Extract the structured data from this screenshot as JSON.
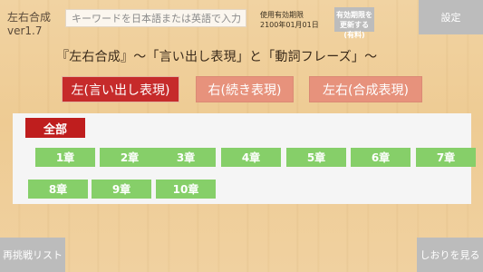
{
  "header": {
    "app_name": "左右合成",
    "version": "ver1.7",
    "search_placeholder": "キーワードを日本語または英語で入力",
    "expiry_label": "使用有効期限",
    "expiry_date": "2100年01月01日",
    "renew_label_1": "有効期限を",
    "renew_label_2": "更新する(有料)",
    "settings_label": "設定"
  },
  "subtitle": "『左右合成』～「言い出し表現」と「動詞フレーズ」～",
  "modes": {
    "left": "左(言い出し表現)",
    "right": "右(続き表現)",
    "both": "左右(合成表現)"
  },
  "chapters": {
    "all_label": "全部",
    "items": [
      "1章",
      "2章",
      "3章",
      "4章",
      "5章",
      "6章",
      "7章",
      "8章",
      "9章",
      "10章"
    ]
  },
  "footer": {
    "retry_label": "再挑戦リスト",
    "bookmark_label": "しおりを見る"
  },
  "colors": {
    "selected_mode": "#c62b2b",
    "unselected_mode": "#e7927c",
    "chapter": "#86cf69",
    "all_selected": "#bf1e1e",
    "gray_button": "#bcbcbc"
  }
}
